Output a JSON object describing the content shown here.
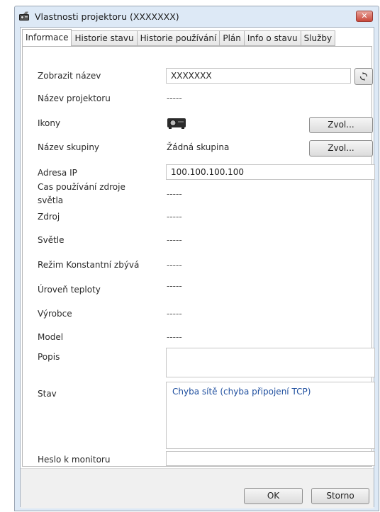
{
  "window": {
    "title": "Vlastnosti projektoru (XXXXXXX)"
  },
  "tabs": [
    {
      "label": "Informace",
      "active": true
    },
    {
      "label": "Historie stavu",
      "active": false
    },
    {
      "label": "Historie používání",
      "active": false
    },
    {
      "label": "Plán",
      "active": false
    },
    {
      "label": "Info o stavu",
      "active": false
    },
    {
      "label": "Služby",
      "active": false
    }
  ],
  "fields": {
    "display_name": {
      "label": "Zobrazit název",
      "value": "XXXXXXX"
    },
    "projector_name": {
      "label": "Název projektoru",
      "value": "-----"
    },
    "icons": {
      "label": "Ikony",
      "button": "Zvol..."
    },
    "group_name": {
      "label": "Název skupiny",
      "value": "Žádná skupina",
      "button": "Zvol..."
    },
    "ip_address": {
      "label": "Adresa IP",
      "value": "100.100.100.100"
    },
    "light_usage": {
      "label_line1": "Cas používání zdroje",
      "label_line2": "světla",
      "value": "-----"
    },
    "source": {
      "label": "Zdroj",
      "value": "-----"
    },
    "light": {
      "label": "Světle",
      "value": "-----"
    },
    "constant_mode": {
      "label": "Režim Konstantní zbývá",
      "value": "-----"
    },
    "temperature": {
      "label": "Úroveň teploty",
      "value": "-----"
    },
    "manufacturer": {
      "label": "Výrobce",
      "value": "-----"
    },
    "model": {
      "label": "Model",
      "value": "-----"
    },
    "description": {
      "label": "Popis",
      "value": ""
    },
    "status": {
      "label": "Stav",
      "value": "Chyba sítě (chyba připojení TCP)"
    },
    "monitor_password": {
      "label": "Heslo k monitoru",
      "value": ""
    }
  },
  "buttons": {
    "ok": "OK",
    "cancel": "Storno"
  },
  "colors": {
    "status_text": "#1f4f9f",
    "window_frame": "#dde9f6"
  }
}
